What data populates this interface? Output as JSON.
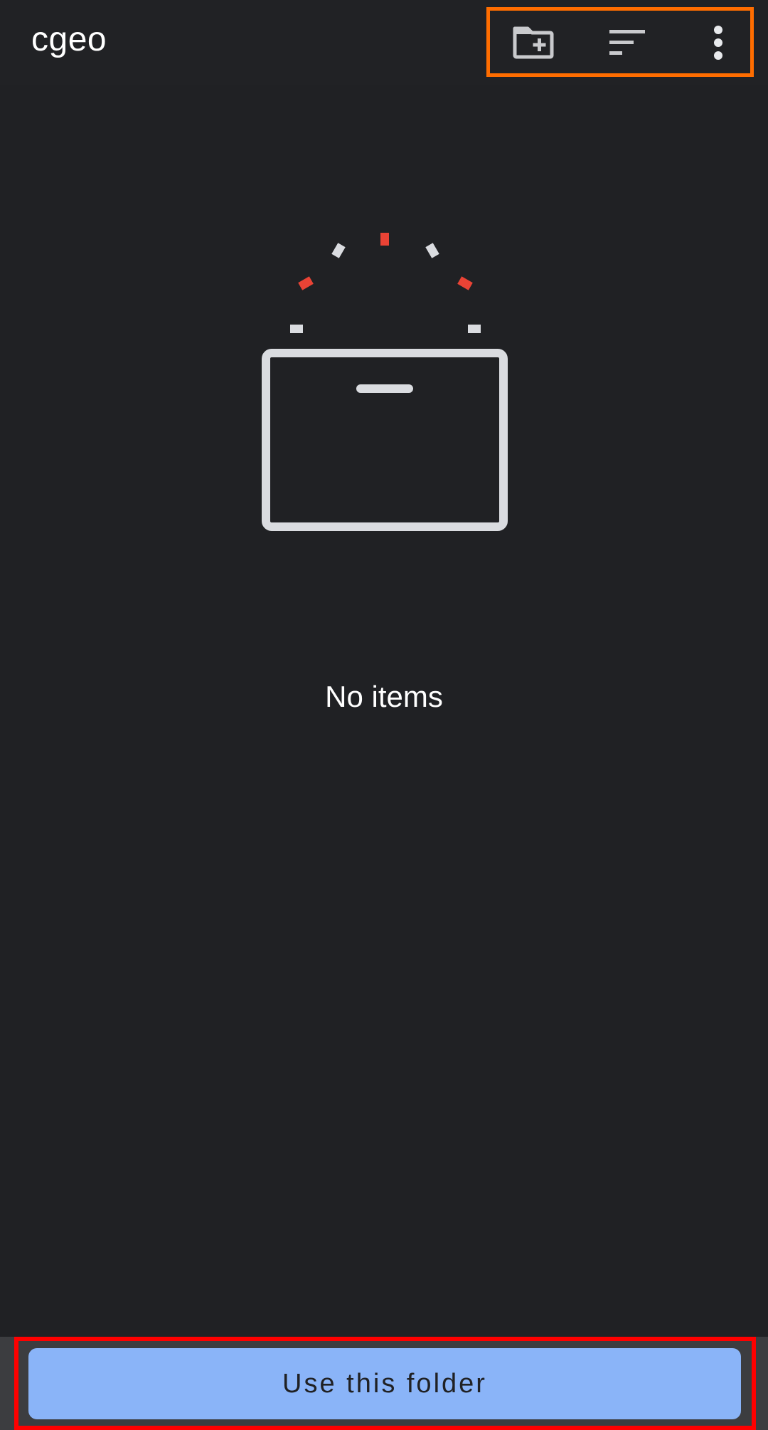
{
  "appbar": {
    "title": "cgeo",
    "actions": [
      {
        "icon": "create-new-folder-icon"
      },
      {
        "icon": "sort-icon"
      },
      {
        "icon": "more-vert-icon"
      }
    ]
  },
  "empty_state": {
    "illustration": "empty-box-icon",
    "message": "No items"
  },
  "bottom": {
    "button_label": "Use this folder"
  },
  "colors": {
    "background": "#202124",
    "icon": "#c9cacd",
    "accent_red": "#ea4335",
    "button": "#8ab4f8",
    "highlight_orange": "#ff6d00",
    "highlight_red": "#ff0000"
  }
}
